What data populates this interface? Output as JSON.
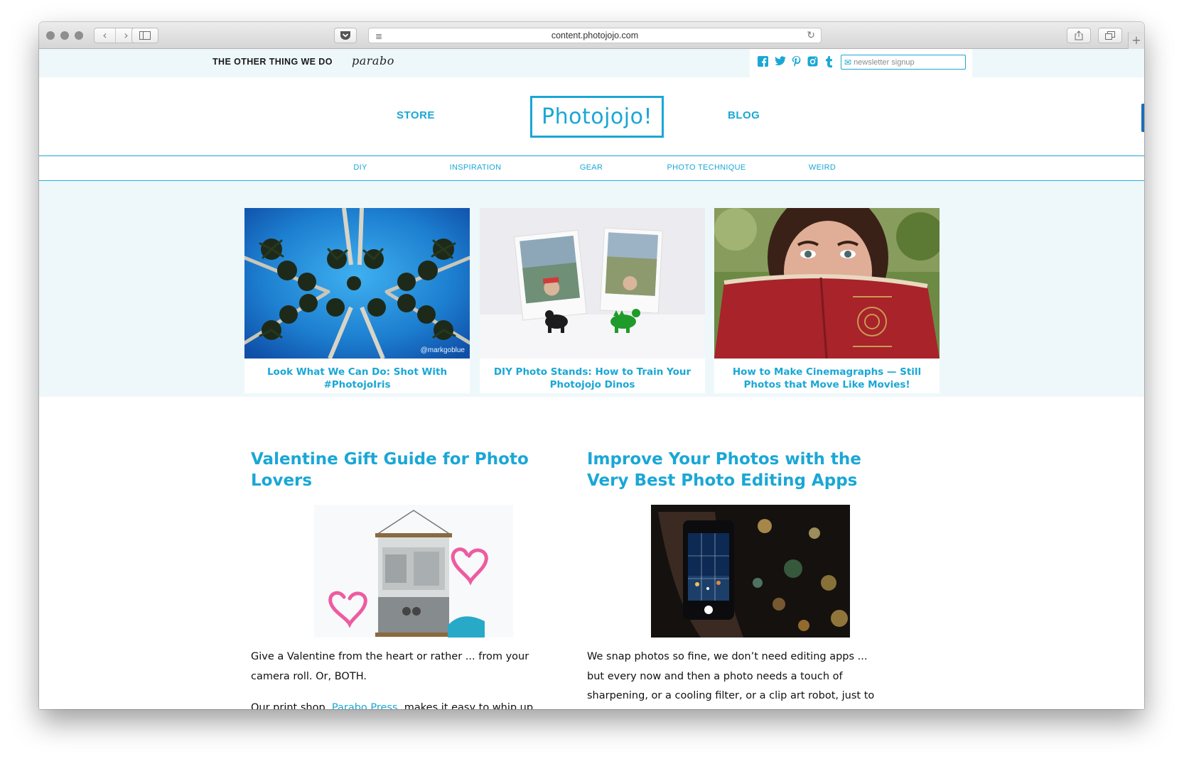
{
  "browser": {
    "url": "content.photojojo.com",
    "new_tab_symbol": "+"
  },
  "topbar": {
    "tagline": "THE OTHER THING WE DO",
    "partner_logo": "parabo",
    "newsletter_placeholder": "newsletter signup",
    "social_icons": [
      "facebook-icon",
      "twitter-icon",
      "pinterest-icon",
      "instagram-icon",
      "tumblr-icon"
    ]
  },
  "header": {
    "store_label": "STORE",
    "logo_text": "Photojojo!",
    "blog_label": "BLOG"
  },
  "categories": [
    "DIY",
    "INSPIRATION",
    "GEAR",
    "PHOTO TECHNIQUE",
    "WEIRD"
  ],
  "featured": [
    {
      "title": "Look What We Can Do: Shot With #PhotojoIris",
      "watermark": "@markgoblue"
    },
    {
      "title": "DIY Photo Stands: How to Train Your Photojojo Dinos"
    },
    {
      "title": "How to Make Cinemagraphs — Still Photos that Move Like Movies!"
    }
  ],
  "posts": [
    {
      "title": "Valentine Gift Guide for Photo Lovers",
      "p1": "Give a Valentine from the heart or rather ... from your camera roll. Or, BOTH.",
      "p2_before": "Our print shop, ",
      "p2_link": "Parabo Press",
      "p2_after": ", makes it easy to whip up"
    },
    {
      "title": "Improve Your Photos with the Very Best Photo Editing Apps",
      "p1": "We snap photos so fine, we don’t need editing apps ... but every now and then a photo needs a touch of sharpening, or a cooling filter, or a clip art robot, just to"
    }
  ],
  "colors": {
    "accent": "#1aa7d6",
    "tint": "#eef8fb",
    "text": "#111111"
  }
}
